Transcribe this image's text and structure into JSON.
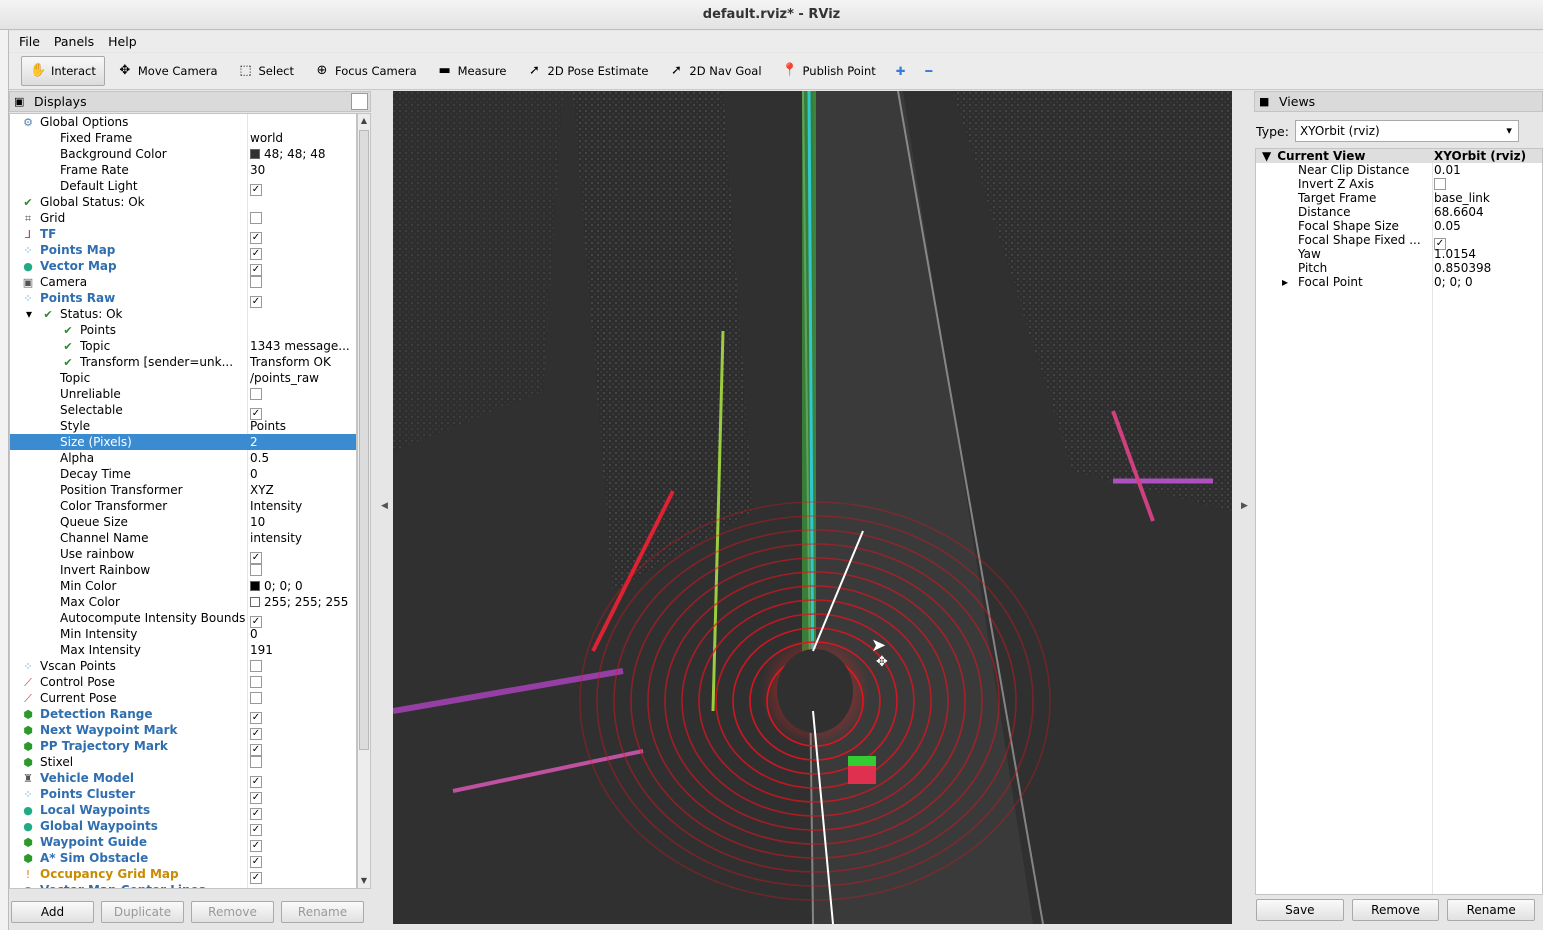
{
  "window": {
    "title": "default.rviz* - RViz"
  },
  "menu": [
    "File",
    "Panels",
    "Help"
  ],
  "toolbar": {
    "tools": [
      {
        "label": "Interact",
        "icon": "interact-icon",
        "glyph": "✋",
        "active": true
      },
      {
        "label": "Move Camera",
        "icon": "move-camera-icon",
        "glyph": "✥"
      },
      {
        "label": "Select",
        "icon": "select-icon",
        "glyph": "⬚"
      },
      {
        "label": "Focus Camera",
        "icon": "focus-camera-icon",
        "glyph": "⊕"
      },
      {
        "label": "Measure",
        "icon": "measure-icon",
        "glyph": "▬"
      },
      {
        "label": "2D Pose Estimate",
        "icon": "pose-estimate-icon",
        "glyph": "➚"
      },
      {
        "label": "2D Nav Goal",
        "icon": "nav-goal-icon",
        "glyph": "➚"
      },
      {
        "label": "Publish Point",
        "icon": "publish-point-icon",
        "glyph": "📍"
      }
    ],
    "add_glyph": "✚",
    "remove_glyph": "━"
  },
  "displays": {
    "title": "Displays",
    "rows": [
      {
        "indent": 0,
        "icon": "gear",
        "name": "Global Options",
        "style": ""
      },
      {
        "indent": 1,
        "name": "Fixed Frame",
        "value": "world"
      },
      {
        "indent": 1,
        "name": "Background Color",
        "value": "48; 48; 48",
        "swatch": "#303030"
      },
      {
        "indent": 1,
        "name": "Frame Rate",
        "value": "30"
      },
      {
        "indent": 1,
        "name": "Default Light",
        "check": true
      },
      {
        "indent": 0,
        "icon": "ok",
        "name": "Global Status: Ok"
      },
      {
        "indent": 0,
        "icon": "grid",
        "name": "Grid",
        "check": false
      },
      {
        "indent": 0,
        "icon": "tf",
        "name": "TF",
        "style": "blue",
        "check": true
      },
      {
        "indent": 0,
        "icon": "points",
        "name": "Points Map",
        "style": "blue",
        "check": true
      },
      {
        "indent": 0,
        "icon": "marker",
        "name": "Vector Map",
        "style": "blue",
        "check": true
      },
      {
        "indent": 0,
        "icon": "camera",
        "name": "Camera",
        "check": false
      },
      {
        "indent": 0,
        "icon": "points",
        "name": "Points Raw",
        "style": "blue",
        "check": true
      },
      {
        "indent": 1,
        "icon": "ok",
        "name": "Status: Ok",
        "expander": "▾"
      },
      {
        "indent": 2,
        "icon": "ok",
        "name": "Points"
      },
      {
        "indent": 2,
        "icon": "ok",
        "name": "Topic",
        "value": "1343 message..."
      },
      {
        "indent": 2,
        "icon": "ok",
        "name": "Transform [sender=unk...",
        "value": "Transform OK"
      },
      {
        "indent": 1,
        "name": "Topic",
        "value": "/points_raw"
      },
      {
        "indent": 1,
        "name": "Unreliable",
        "check": false
      },
      {
        "indent": 1,
        "name": "Selectable",
        "check": true
      },
      {
        "indent": 1,
        "name": "Style",
        "value": "Points"
      },
      {
        "indent": 1,
        "name": "Size (Pixels)",
        "value": "2",
        "selected": true
      },
      {
        "indent": 1,
        "name": "Alpha",
        "value": "0.5"
      },
      {
        "indent": 1,
        "name": "Decay Time",
        "value": "0"
      },
      {
        "indent": 1,
        "name": "Position Transformer",
        "value": "XYZ"
      },
      {
        "indent": 1,
        "name": "Color Transformer",
        "value": "Intensity"
      },
      {
        "indent": 1,
        "name": "Queue Size",
        "value": "10"
      },
      {
        "indent": 1,
        "name": "Channel Name",
        "value": "intensity"
      },
      {
        "indent": 1,
        "name": "Use rainbow",
        "check": true
      },
      {
        "indent": 1,
        "name": "Invert Rainbow",
        "check": false
      },
      {
        "indent": 1,
        "name": "Min Color",
        "value": "0; 0; 0",
        "swatch": "#000000"
      },
      {
        "indent": 1,
        "name": "Max Color",
        "value": "255; 255; 255",
        "swatch": "#ffffff"
      },
      {
        "indent": 1,
        "name": "Autocompute Intensity Bounds",
        "check": true
      },
      {
        "indent": 1,
        "name": "Min Intensity",
        "value": "0"
      },
      {
        "indent": 1,
        "name": "Max Intensity",
        "value": "191"
      },
      {
        "indent": 0,
        "icon": "points",
        "name": "Vscan Points",
        "check": false
      },
      {
        "indent": 0,
        "icon": "pose",
        "name": "Control Pose",
        "check": false
      },
      {
        "indent": 0,
        "icon": "pose",
        "name": "Current Pose",
        "check": false
      },
      {
        "indent": 0,
        "icon": "cube",
        "name": "Detection Range",
        "style": "blue",
        "check": true
      },
      {
        "indent": 0,
        "icon": "cube",
        "name": "Next Waypoint Mark",
        "style": "blue",
        "check": true
      },
      {
        "indent": 0,
        "icon": "cube",
        "name": "PP Trajectory Mark",
        "style": "blue",
        "check": true
      },
      {
        "indent": 0,
        "icon": "cube",
        "name": "Stixel",
        "check": false
      },
      {
        "indent": 0,
        "icon": "robot",
        "name": "Vehicle Model",
        "style": "blue",
        "check": true
      },
      {
        "indent": 0,
        "icon": "points",
        "name": "Points Cluster",
        "style": "blue",
        "check": true
      },
      {
        "indent": 0,
        "icon": "marker",
        "name": "Local Waypoints",
        "style": "blue",
        "check": true
      },
      {
        "indent": 0,
        "icon": "marker",
        "name": "Global Waypoints",
        "style": "blue",
        "check": true
      },
      {
        "indent": 0,
        "icon": "cube",
        "name": "Waypoint Guide",
        "style": "blue",
        "check": true
      },
      {
        "indent": 0,
        "icon": "cube",
        "name": "A* Sim Obstacle",
        "style": "blue",
        "check": true
      },
      {
        "indent": 0,
        "icon": "warn",
        "name": "Occupancy Grid Map",
        "style": "orange",
        "check": true
      },
      {
        "indent": 0,
        "icon": "marker",
        "name": "Vector Map Center Lines",
        "style": "blue",
        "check": true
      }
    ],
    "buttons": [
      {
        "label": "Add",
        "enabled": true
      },
      {
        "label": "Duplicate",
        "enabled": false
      },
      {
        "label": "Remove",
        "enabled": false
      },
      {
        "label": "Rename",
        "enabled": false
      }
    ]
  },
  "views": {
    "title": "Views",
    "type_label": "Type:",
    "type_value": "XYOrbit (rviz)",
    "current_view": {
      "name": "Current View",
      "value": "XYOrbit (rviz)"
    },
    "rows": [
      {
        "name": "Near Clip Distance",
        "value": "0.01"
      },
      {
        "name": "Invert Z Axis",
        "check": false
      },
      {
        "name": "Target Frame",
        "value": "base_link"
      },
      {
        "name": "Distance",
        "value": "68.6604"
      },
      {
        "name": "Focal Shape Size",
        "value": "0.05"
      },
      {
        "name": "Focal Shape Fixed ...",
        "check": true
      },
      {
        "name": "Yaw",
        "value": "1.0154"
      },
      {
        "name": "Pitch",
        "value": "0.850398"
      },
      {
        "name": "Focal Point",
        "value": "0; 0; 0",
        "expander": "▸"
      }
    ],
    "buttons": [
      "Save",
      "Remove",
      "Rename"
    ]
  },
  "colors": {
    "selection": "#3b8bd0",
    "viewport_bg": "#303030",
    "ring": "#e0141e",
    "track_green": "#3fbf3f"
  }
}
